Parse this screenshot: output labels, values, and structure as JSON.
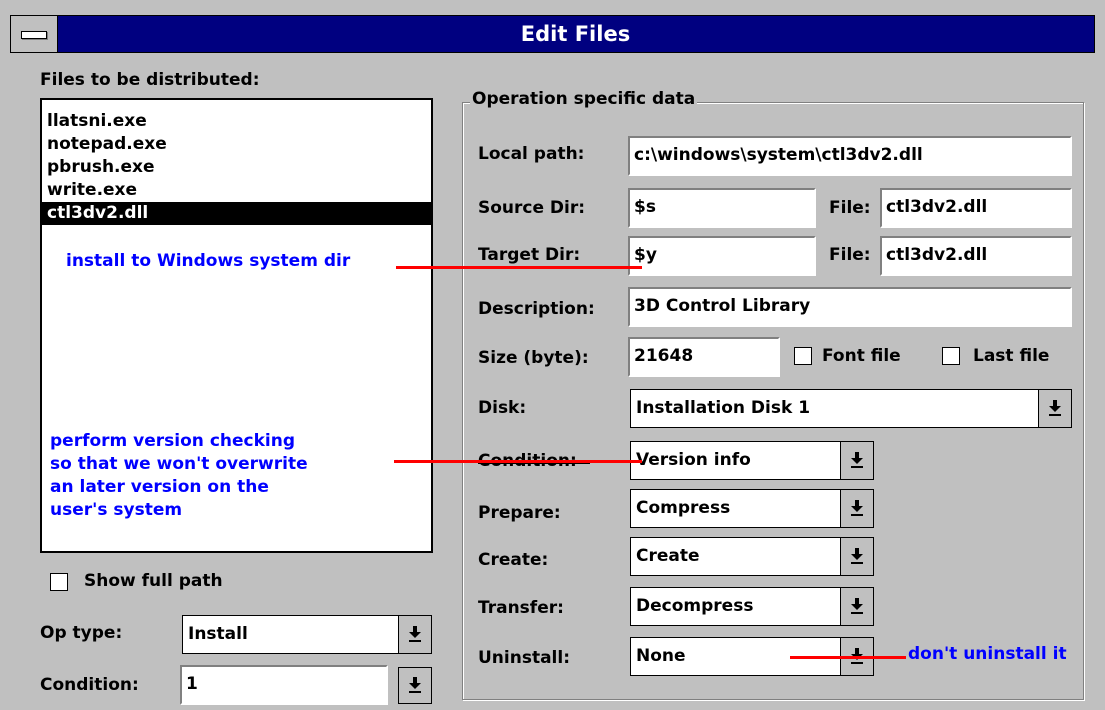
{
  "window": {
    "title": "Edit Files"
  },
  "files_panel": {
    "label": "Files to be distributed:",
    "files": [
      "llatsni.exe",
      "notepad.exe",
      "pbrush.exe",
      "write.exe",
      "ctl3dv2.dll"
    ],
    "selected_index": 4,
    "show_full_path_label": "Show full path",
    "show_full_path_checked": false,
    "op_type_label": "Op type:",
    "op_type_value": "Install",
    "condition_label": "Condition:",
    "condition_value": "1"
  },
  "group": {
    "legend": "Operation specific data",
    "local_path_label": "Local path:",
    "local_path_value": "c:\\windows\\system\\ctl3dv2.dll",
    "source_dir_label": "Source  Dir:",
    "source_dir_value": "$s",
    "source_file_label": "File:",
    "source_file_value": "ctl3dv2.dll",
    "target_dir_label": "Target   Dir:",
    "target_dir_value": "$y",
    "target_file_label": "File:",
    "target_file_value": "ctl3dv2.dll",
    "description_label": "Description:",
    "description_value": "3D Control Library",
    "size_label": "Size (byte):",
    "size_value": "21648",
    "font_file_label": "Font file",
    "font_file_checked": false,
    "last_file_label": "Last file",
    "last_file_checked": false,
    "disk_label": "Disk:",
    "disk_value": "Installation Disk 1",
    "condition_label": "Condition:",
    "condition_value": "Version info",
    "prepare_label": "Prepare:",
    "prepare_value": "Compress",
    "create_label": "Create:",
    "create_value": "Create",
    "transfer_label": "Transfer:",
    "transfer_value": "Decompress",
    "uninstall_label": "Uninstall:",
    "uninstall_value": "None"
  },
  "annotations": {
    "install_note": "install to Windows system dir",
    "version_note": [
      "perform version checking",
      "so that we won't overwrite",
      "an later version on the",
      "user's system"
    ],
    "uninstall_note": "don't uninstall it"
  },
  "colors": {
    "titlebar": "#000080",
    "annotation_text": "#0000ff",
    "annotation_line": "#ff0000",
    "background": "#c0c0c0"
  }
}
